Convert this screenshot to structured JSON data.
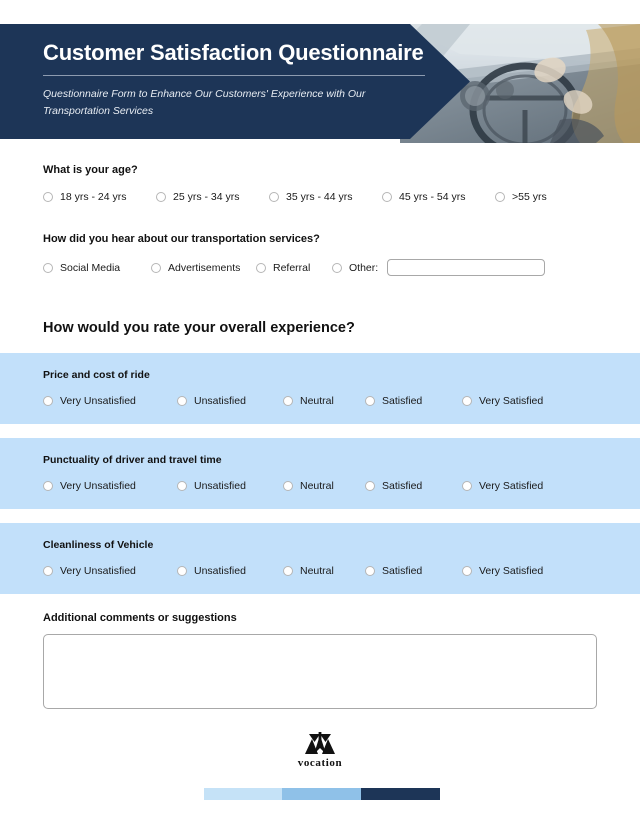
{
  "header": {
    "title": "Customer Satisfaction Questionnaire",
    "subtitle": "Questionnaire Form to Enhance Our Customers' Experience with Our Transportation Services",
    "photo_alt": "woman-driving-car-photo",
    "banner_color": "#1d3557",
    "rule_color": "#8d9bb0"
  },
  "questions": [
    {
      "label": "What is your age?",
      "options": [
        "18 yrs - 24 yrs",
        "25 yrs - 34 yrs",
        "35 yrs - 44 yrs",
        "45 yrs - 54 yrs",
        ">55 yrs"
      ]
    },
    {
      "label": "How did you hear about our transportation services?",
      "options": [
        "Social Media",
        "Advertisements",
        "Referral",
        "Other:"
      ],
      "other_input_value": "",
      "other_input_placeholder": ""
    }
  ],
  "rating_section": {
    "title": "How would you rate your overall experience?",
    "scale": [
      "Very Unsatisfied",
      "Unsatisfied",
      "Neutral",
      "Satisfied",
      "Very Satisfied"
    ],
    "band_color": "#c2e0fa",
    "items": [
      {
        "label": "Price and cost of ride"
      },
      {
        "label": "Punctuality of driver and travel time"
      },
      {
        "label": "Cleanliness of Vehicle"
      }
    ]
  },
  "comments": {
    "label": "Additional comments or suggestions",
    "value": "",
    "placeholder": ""
  },
  "footer": {
    "logo_mark": "vocation-monogram-icon",
    "logo_word": "vocation",
    "color_bar": [
      "#c5e2f7",
      "#8fc1e8",
      "#1d3557"
    ]
  }
}
